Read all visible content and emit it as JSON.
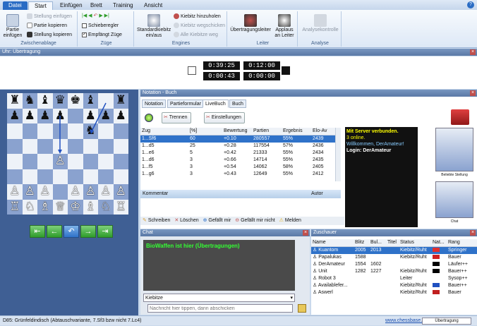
{
  "ribbon": {
    "tabs": [
      "Datei",
      "Start",
      "Einfügen",
      "Brett",
      "Training",
      "Ansicht"
    ],
    "help": "?",
    "clipboard": {
      "paste": "Partie einfügen",
      "items": [
        "Stellung einfügen",
        "Partie kopieren",
        "Stellung kopieren"
      ],
      "label": "Zwischenablage"
    },
    "moves": {
      "items": [
        "Schieberegler",
        "Empfängt Züge"
      ],
      "label": "Züge"
    },
    "engines": {
      "standard": "Standardkiebitz ein/aus",
      "items": [
        "Kiebitz hinzuholen",
        "Kiebitz wegschicken",
        "Alle Kiebitze weg"
      ],
      "label": "Engines"
    },
    "leader": {
      "items": [
        "Übertragungsleiter",
        "Applaus an Leiter"
      ],
      "label": "Leiter"
    },
    "analysis": {
      "items": [
        "Analysekontrolle"
      ],
      "label": "Analyse"
    }
  },
  "clock": {
    "title": "Uhr: Übertragung",
    "times": [
      "0:39:25",
      "0:12:00",
      "0:00:43",
      "0:00:00"
    ]
  },
  "notation": {
    "title": "Notation - Buch",
    "tabs": [
      "Notation",
      "Partieformular",
      "LiveBuch",
      "Buch"
    ],
    "trennen": "Trennen",
    "settings": "Einstellungen",
    "columns": [
      "Zug",
      "[%]",
      "Bewertung",
      "Partien",
      "Ergebnis",
      "Elo-Av"
    ],
    "rows": [
      [
        "1...Sf6",
        "60",
        "+0.10",
        "280557",
        "55%",
        "2439"
      ],
      [
        "1...d5",
        "25",
        "+0.28",
        "117554",
        "57%",
        "2436"
      ],
      [
        "1...e6",
        "5",
        "+0.42",
        "21333",
        "55%",
        "2434"
      ],
      [
        "1...d6",
        "3",
        "+0.66",
        "14714",
        "55%",
        "2435"
      ],
      [
        "1...f5",
        "3",
        "+0.54",
        "14062",
        "58%",
        "2405"
      ],
      [
        "1...g6",
        "3",
        "+0.43",
        "12649",
        "55%",
        "2412"
      ]
    ],
    "comment": "Kommentar",
    "author": "Autor",
    "actions": [
      "Schreiben",
      "Löschen",
      "Gefällt mir",
      "Gefällt mir nicht",
      "Melden"
    ],
    "server": [
      "Mit Server verbunden.",
      "3 online.",
      "Willkommen, DerAmateur!",
      "Login: DerAmateur"
    ],
    "thumbs": [
      "Beliebte Stellung",
      "Chat"
    ]
  },
  "chat": {
    "title": "Chat",
    "message": "BioWaffen ist hier (Übertragungen)",
    "select": "Kiebitze",
    "placeholder": "Nachricht hier tippen, dann abschicken"
  },
  "spectators": {
    "title": "Zuschauer",
    "columns": [
      "Name",
      "Blitz",
      "Bul...",
      "Titel",
      "Status",
      "Nat...",
      "Rang"
    ],
    "rows": [
      [
        "Kuantom",
        "2005",
        "2013",
        "",
        "Kiebitz/Ruht",
        "",
        "Springer"
      ],
      [
        "Papalukas",
        "1588",
        "",
        "",
        "Kiebitz/Ruht",
        "",
        "Bauer"
      ],
      [
        "DerAmateur",
        "1554",
        "1602",
        "",
        "",
        "",
        "Läufer++"
      ],
      [
        "Unit",
        "1282",
        "1227",
        "",
        "Kiebitz/Ruht",
        "",
        "Bauer++"
      ],
      [
        "Robot 3",
        "",
        "",
        "",
        "Leiter",
        "",
        "Sysop++"
      ],
      [
        "Availablefer...",
        "",
        "",
        "",
        "Kiebitz/Ruht",
        "",
        "Bauer++"
      ],
      [
        "Aswerl",
        "",
        "",
        "",
        "Kiebitz/Ruht",
        "",
        "Bauer"
      ]
    ]
  },
  "status": {
    "text": "D85: Grünfeldindisch (Abtauschvariante, 7.Sf3 bzw nicht 7.Lc4)",
    "link": "www.chessbase.de",
    "mode": "Übertragung"
  },
  "colors": {
    "accent": "#2f72c9",
    "titlebar": "#5a78a6",
    "board_dark": "#8aa2cf"
  }
}
